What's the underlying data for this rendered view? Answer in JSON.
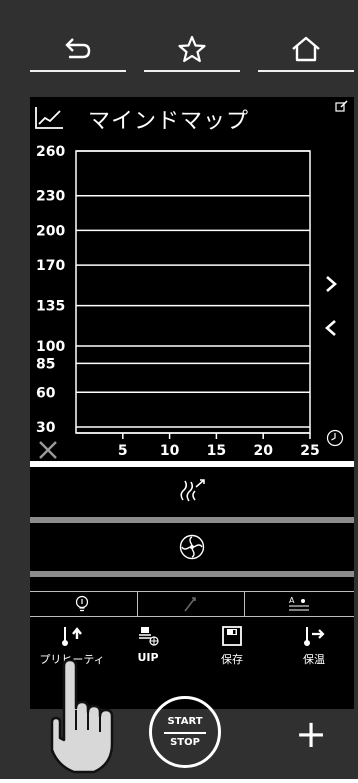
{
  "nav": {
    "icons": [
      "back-arrow-icon",
      "star-icon",
      "home-icon"
    ]
  },
  "header": {
    "title": "マインドマップ",
    "icon": "line-chart-icon"
  },
  "chart_data": {
    "type": "line",
    "x_ticks": [
      "5",
      "10",
      "15",
      "20",
      "25"
    ],
    "y_ticks": [
      "260",
      "230",
      "200",
      "170",
      "135",
      "100",
      "85",
      "60",
      "30"
    ],
    "xlim": [
      0,
      25
    ],
    "gridlines_y": true,
    "series": []
  },
  "bottom_bar": {
    "preheat_label": "プリヒーティ",
    "uip_label": "UIP",
    "save_label": "保存",
    "keepwarm_label": "保温"
  },
  "control": {
    "start_label": "START",
    "stop_label": "STOP",
    "plus_label": "+"
  }
}
